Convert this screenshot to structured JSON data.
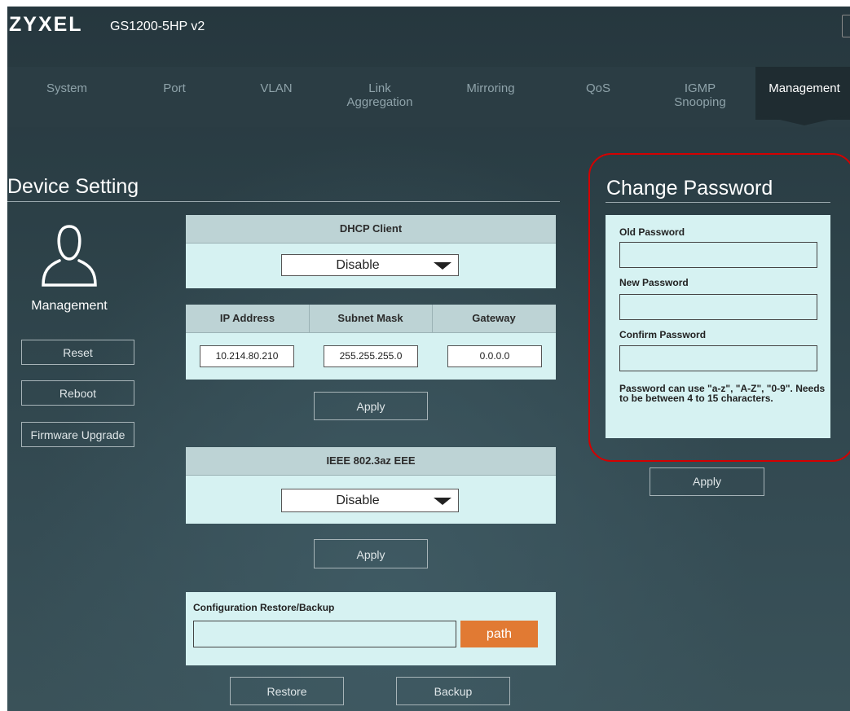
{
  "header": {
    "brand": "ZYXEL",
    "model": "GS1200-5HP v2"
  },
  "nav": {
    "items": [
      {
        "label": "System"
      },
      {
        "label": "Port"
      },
      {
        "label": "VLAN"
      },
      {
        "label": "Link\nAggregation"
      },
      {
        "label": "Mirroring"
      },
      {
        "label": "QoS"
      },
      {
        "label": "IGMP\nSnooping"
      },
      {
        "label": "Management"
      }
    ],
    "active": "Management"
  },
  "device": {
    "title": "Device Setting",
    "section_label": "Management",
    "buttons": {
      "reset": "Reset",
      "reboot": "Reboot",
      "firmware": "Firmware Upgrade"
    },
    "dhcp": {
      "header": "DHCP Client",
      "value": "Disable"
    },
    "ip": {
      "headers": {
        "ip": "IP Address",
        "mask": "Subnet Mask",
        "gateway": "Gateway"
      },
      "values": {
        "ip": "10.214.80.210",
        "mask": "255.255.255.0",
        "gateway": "0.0.0.0"
      },
      "apply": "Apply"
    },
    "eee": {
      "header": "IEEE 802.3az EEE",
      "value": "Disable",
      "apply": "Apply"
    },
    "config": {
      "label": "Configuration Restore/Backup",
      "path_value": "",
      "path_button": "path",
      "restore": "Restore",
      "backup": "Backup"
    }
  },
  "password": {
    "title": "Change Password",
    "old_label": "Old Password",
    "new_label": "New Password",
    "confirm_label": "Confirm Password",
    "hint": "Password can use \"a-z\", \"A-Z\", \"0-9\". Needs to be between 4 to 15 characters.",
    "apply": "Apply"
  },
  "colors": {
    "accent_orange": "#e17a33",
    "highlight_red": "#d40000",
    "panel_bg": "#d6f2f2"
  }
}
